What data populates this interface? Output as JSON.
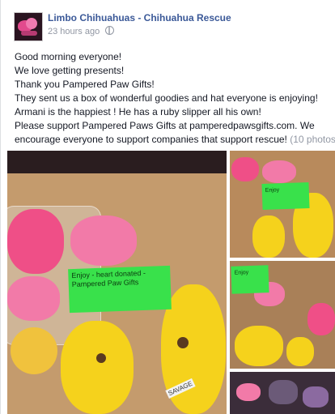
{
  "header": {
    "page_name": "Limbo Chihuahuas - Chihuahua Rescue",
    "timestamp": "23 hours ago"
  },
  "post": {
    "lines": [
      "Good morning everyone!",
      "We love getting presents!",
      "Thank you Pampered Paw Gifts!",
      "They sent us a box of wonderful goodies and hat everyone is enjoying!",
      "Armani is the happiest ! He has a ruby slipper all his own!",
      "Please support Pampered Paws Gifts at pamperedpawsgifts.com. We",
      "encourage everyone to support companies that support rescue!"
    ],
    "photo_count_label": "(10 photos)"
  },
  "photos": {
    "big_note": "Enjoy - heart donated - Pampered Paw Gifts",
    "small_note": "Enjoy",
    "tag_text": "SAVAGE"
  },
  "colors": {
    "link": "#3b5998",
    "text": "#141823",
    "muted": "#9197a3",
    "note_green": "#39e14b"
  }
}
